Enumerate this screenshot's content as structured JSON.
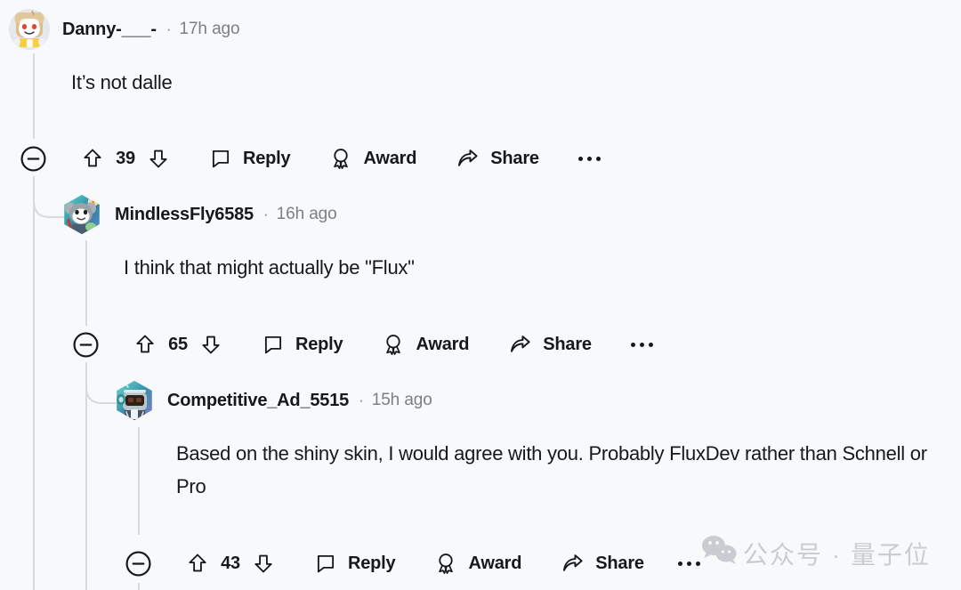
{
  "page": {
    "background_color": "#f8f9fb",
    "text_color": "#16181c",
    "muted_color": "#7c7f83",
    "thread_line_color": "#d8dade"
  },
  "actions": {
    "collapse_icon": "circle-minus-icon",
    "upvote_icon": "upvote-arrow-icon",
    "downvote_icon": "downvote-arrow-icon",
    "reply_icon": "speech-bubble-icon",
    "reply_label": "Reply",
    "award_icon": "award-rosette-icon",
    "award_label": "Award",
    "share_icon": "share-arrow-icon",
    "share_label": "Share",
    "overflow_icon": "more-options-icon"
  },
  "comments": [
    {
      "id": "comment-1",
      "depth": 0,
      "author": "Danny-___-",
      "separator": "·",
      "timestamp": "17h ago",
      "body": "It’s not dalle",
      "score": "39",
      "avatar": "snoo-bread-avatar"
    },
    {
      "id": "comment-2",
      "depth": 1,
      "author": "MindlessFly6585",
      "separator": "·",
      "timestamp": "16h ago",
      "body": "I think that might actually be \"Flux\"",
      "score": "65",
      "avatar": "snoo-koala-avatar"
    },
    {
      "id": "comment-3",
      "depth": 2,
      "author": "Competitive_Ad_5515",
      "separator": "·",
      "timestamp": "15h ago",
      "body": "Based on the shiny skin, I would agree with you. Probably FluxDev rather than Schnell or Pro",
      "score": "43",
      "avatar": "snoo-robot-avatar"
    }
  ],
  "watermark": {
    "icon": "wechat-logo-icon",
    "text": "公众号 · 量子位",
    "color": "#c9ccd1"
  }
}
